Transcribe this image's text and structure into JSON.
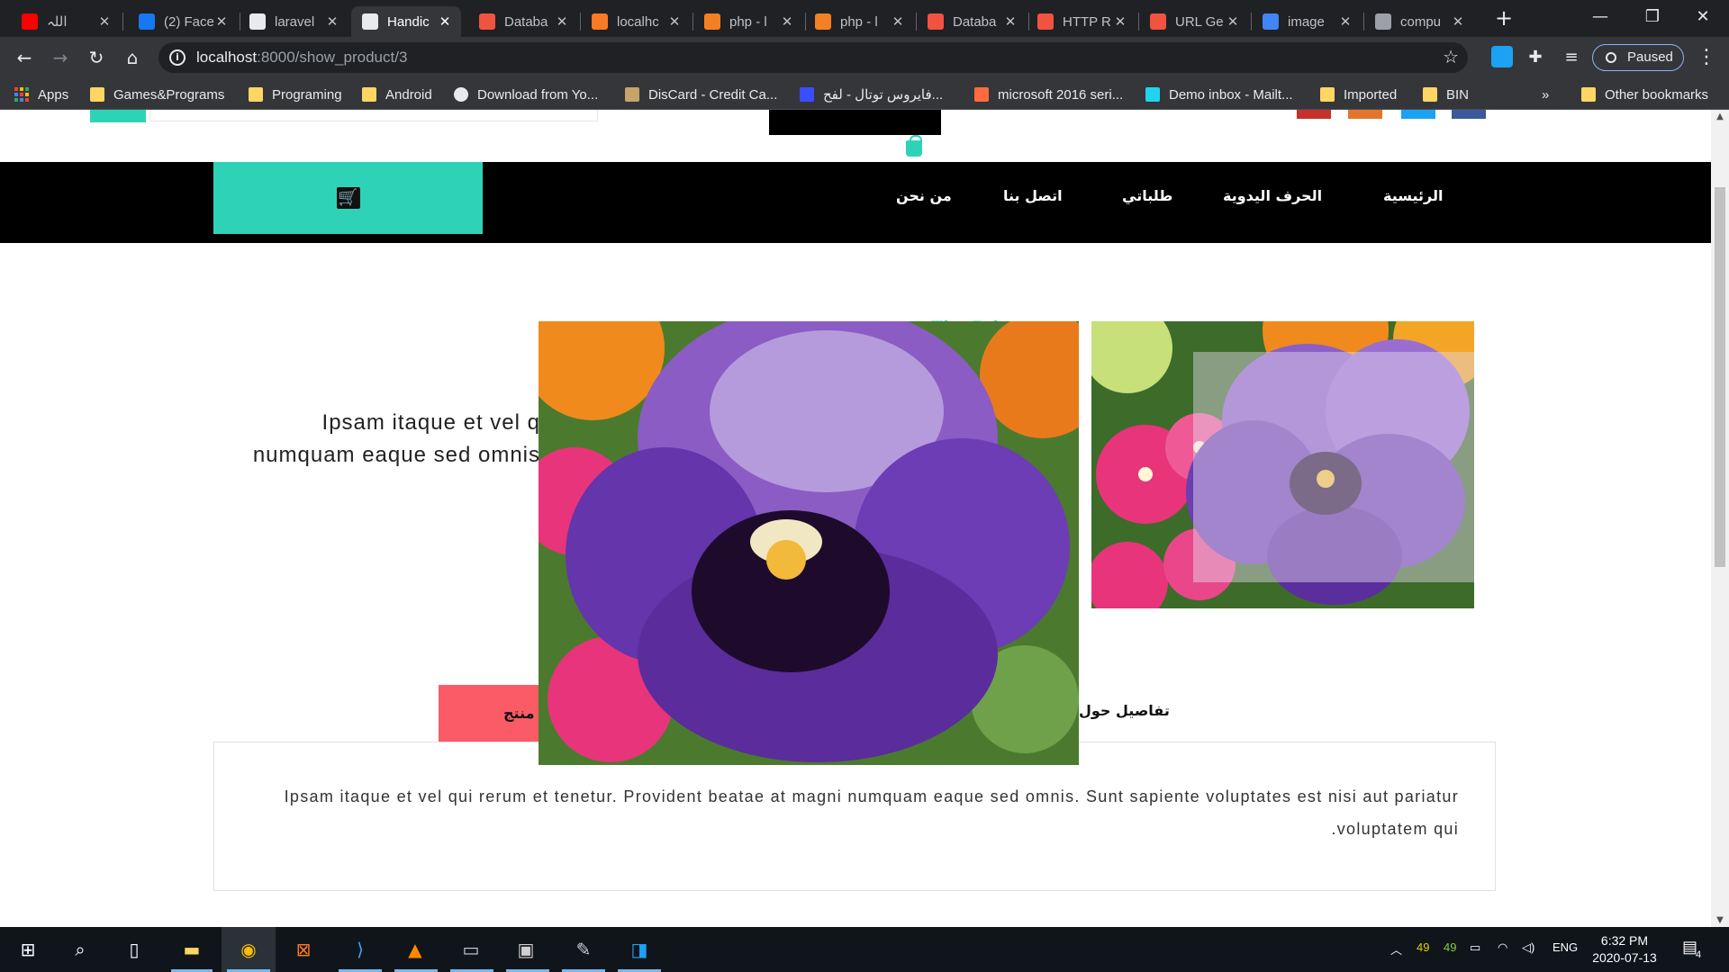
{
  "browser": {
    "tabs": [
      {
        "title": "اللہ",
        "favicon": "youtube-icon",
        "color": "#ff0000"
      },
      {
        "title": "(2) Face",
        "favicon": "facebook-icon",
        "color": "#1877f2"
      },
      {
        "title": "laravel",
        "favicon": "github-icon",
        "color": "#e8eaed"
      },
      {
        "title": "Handic",
        "favicon": "globe-icon",
        "color": "#e8eaed",
        "active": true
      },
      {
        "title": "Databa",
        "favicon": "laravel-icon",
        "color": "#f05340"
      },
      {
        "title": "localhc",
        "favicon": "xampp-icon",
        "color": "#fb7a24"
      },
      {
        "title": "php - l",
        "favicon": "stackoverflow-icon",
        "color": "#f48024"
      },
      {
        "title": "php - l",
        "favicon": "stackoverflow-icon",
        "color": "#f48024"
      },
      {
        "title": "Databa",
        "favicon": "laravel-icon",
        "color": "#f05340"
      },
      {
        "title": "HTTP R",
        "favicon": "laravel-icon",
        "color": "#f05340"
      },
      {
        "title": "URL Ge",
        "favicon": "laravel-icon",
        "color": "#f05340"
      },
      {
        "title": "image",
        "favicon": "google-icon",
        "color": "#4285f4"
      },
      {
        "title": "compu",
        "favicon": "globe-icon",
        "color": "#9aa0a6"
      }
    ],
    "new_tab": "+",
    "window_controls": {
      "minimize": "—",
      "restore": "❐",
      "close": "✕"
    },
    "url_host": "localhost",
    "url_path": ":8000/show_product/3",
    "profile_label": "Paused",
    "bookmarks": [
      {
        "label": "Apps",
        "icon": "apps-grid-icon"
      },
      {
        "label": "Games&Programs",
        "icon": "folder-icon"
      },
      {
        "label": "Programing",
        "icon": "folder-icon"
      },
      {
        "label": "Android",
        "icon": "folder-icon"
      },
      {
        "label": "Download from Yo...",
        "icon": "globe-icon"
      },
      {
        "label": "DisCard - Credit Ca...",
        "icon": "discard-icon"
      },
      {
        "label": "فايروس توتال - لفح...",
        "icon": "virustotal-icon"
      },
      {
        "label": "microsoft 2016 seri...",
        "icon": "microsoft-icon"
      },
      {
        "label": "Demo inbox - Mailt...",
        "icon": "mailtrap-icon"
      },
      {
        "label": "Imported",
        "icon": "folder-icon"
      },
      {
        "label": "BIN",
        "icon": "folder-icon"
      }
    ],
    "bookmarks_overflow": "»",
    "other_bookmarks": "Other bookmarks"
  },
  "site": {
    "nav": [
      "الرئيسية",
      "الحرف اليدوية",
      "طلباتي",
      "اتصل بنا",
      "من نحن"
    ],
    "cart_icon": "cart-icon",
    "brand_color": "#2ed3b7"
  },
  "product": {
    "title_partial": "The Pri...",
    "desc_line1": "Ipsam itaque et vel q",
    "desc_line2": "numquam eaque sed omnis",
    "tab_reviews": "منتج",
    "tab_details": "تفاصيل حول",
    "description": "Ipsam itaque et vel qui rerum et tenetur. Provident beatae at magni numquam eaque sed omnis. Sunt sapiente voluptates est nisi aut pariatur voluptatem qui."
  },
  "taskbar": {
    "tray_num1": "49",
    "tray_num2": "49",
    "language": "ENG",
    "time": "6:32 PM",
    "date": "2020-07-13",
    "notifications": "4"
  }
}
